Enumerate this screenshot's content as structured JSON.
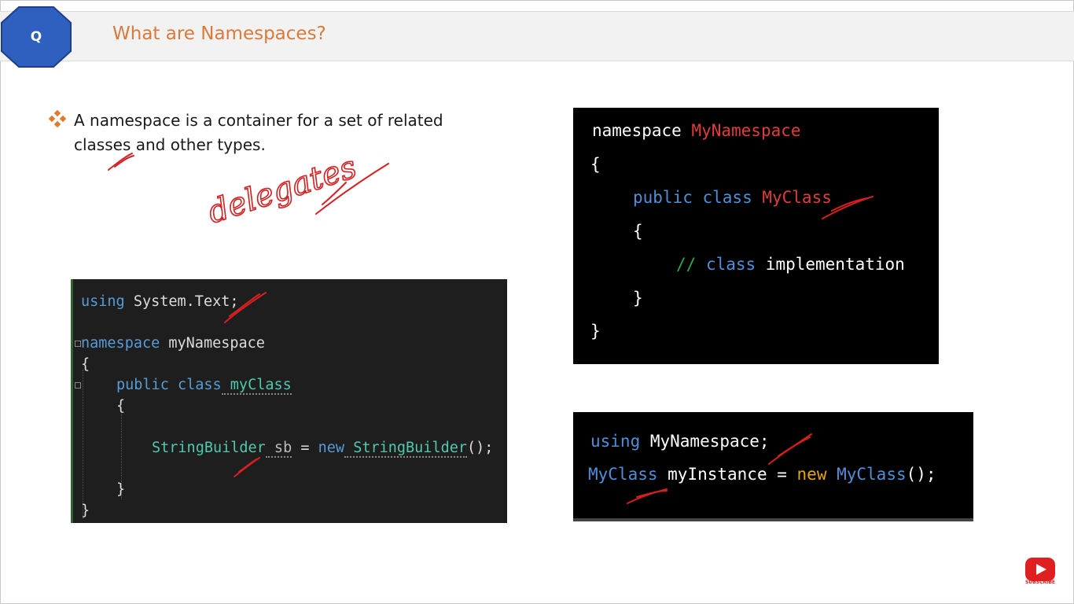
{
  "header": {
    "badge_letter": "Q",
    "title": "What are Namespaces?"
  },
  "bullet": {
    "text": "A namespace is a container for a set of related classes and other types."
  },
  "annotation": {
    "handwritten_word": "delegates"
  },
  "vs_code": {
    "line1": [
      "using",
      " System.Text;"
    ],
    "line2": [
      "namespace",
      " myNamespace"
    ],
    "line3": "{",
    "line4": [
      "public",
      " class",
      " myClass"
    ],
    "line5": "{",
    "line6": [
      "StringBuilder",
      " sb",
      " = ",
      "new",
      " StringBuilder",
      "();"
    ],
    "line7": "}",
    "line8": "}"
  },
  "namespace_code": {
    "line1": [
      "namespace",
      " MyNamespace"
    ],
    "line2": "{",
    "line3": [
      "public",
      " class",
      " MyClass"
    ],
    "line4": "{",
    "line5": [
      "//",
      " class",
      " implementation"
    ],
    "line6": "}",
    "line7": "}"
  },
  "usage_code": {
    "line1": [
      "using",
      " MyNamespace;"
    ],
    "line2": [
      "MyClass",
      " myInstance = ",
      "new",
      " MyClass",
      "();"
    ]
  },
  "subscribe": {
    "icon": "youtube-play-icon",
    "label": "SUBSCRIBE"
  },
  "colors": {
    "title_orange": "#d97a3a",
    "badge_blue": "#2f5fbf",
    "ink_red": "#d42020",
    "keyword_blue": "#569cd6",
    "type_teal": "#4ec9b0"
  }
}
